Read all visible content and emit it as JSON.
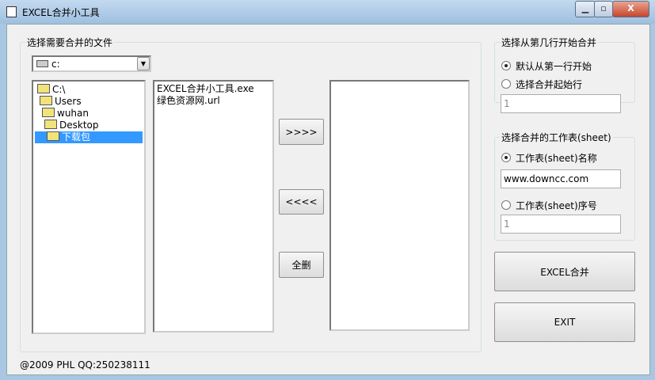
{
  "window": {
    "title": "EXCEL合并小工具",
    "minimize": "▁",
    "maximize": "▫",
    "close": "X"
  },
  "files_group": {
    "label": "选择需要合并的文件",
    "drive": "c:",
    "dirs": [
      "C:\\",
      "Users",
      "wuhan",
      "Desktop",
      "下载包"
    ],
    "files": [
      "EXCEL合并小工具.exe",
      "绿色资源网.url"
    ],
    "selected": []
  },
  "buttons": {
    "add": ">>>>",
    "remove": "<<<<",
    "clear": "全删",
    "merge": "EXCEL合并",
    "exit": "EXIT"
  },
  "start_row_group": {
    "label": "选择从第几行开始合并",
    "opt_default": "默认从第一行开始",
    "opt_custom": "选择合并起始行",
    "value": "1"
  },
  "sheet_group": {
    "label": "选择合并的工作表(sheet)",
    "opt_name": "工作表(sheet)名称",
    "name_value": "www.downcc.com",
    "opt_index": "工作表(sheet)序号",
    "index_value": "1"
  },
  "footer": "@2009 PHL QQ:250238111"
}
